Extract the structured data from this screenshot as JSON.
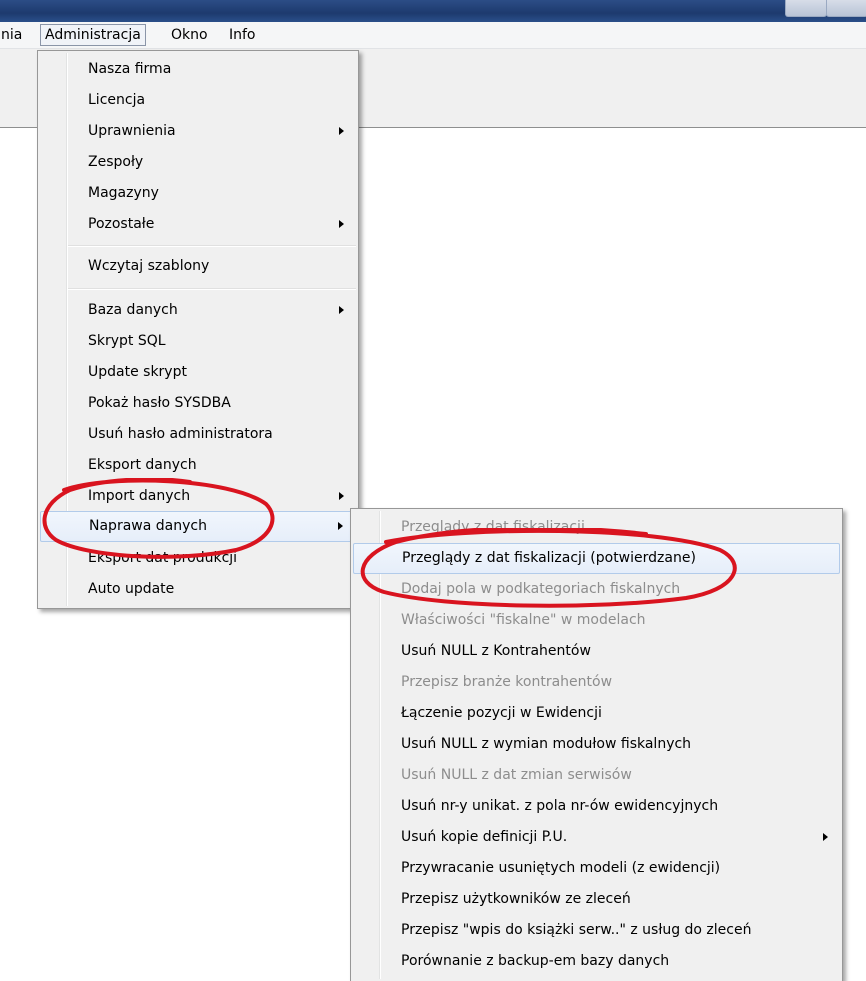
{
  "menubar": {
    "items": [
      "nia",
      "Administracja",
      "Okno",
      "Info"
    ]
  },
  "admin_menu": {
    "items": [
      {
        "label": "Nasza firma",
        "submenu": false
      },
      {
        "label": "Licencja",
        "submenu": false
      },
      {
        "label": "Uprawnienia",
        "submenu": true
      },
      {
        "label": "Zespoły",
        "submenu": false
      },
      {
        "label": "Magazyny",
        "submenu": false
      },
      {
        "label": "Pozostałe",
        "submenu": true
      },
      {
        "label": "Wczytaj szablony",
        "submenu": false
      },
      {
        "label": "Baza danych",
        "submenu": true
      },
      {
        "label": "Skrypt SQL",
        "submenu": false
      },
      {
        "label": "Update skrypt",
        "submenu": false
      },
      {
        "label": "Pokaż hasło SYSDBA",
        "submenu": false
      },
      {
        "label": "Usuń hasło administratora",
        "submenu": false
      },
      {
        "label": "Eksport danych",
        "submenu": false
      },
      {
        "label": "Import danych",
        "submenu": true
      },
      {
        "label": "Naprawa danych",
        "submenu": true
      },
      {
        "label": "Eksport dat produkcji",
        "submenu": false
      },
      {
        "label": "Auto update",
        "submenu": false
      }
    ]
  },
  "repair_menu": {
    "items": [
      {
        "label": "Przeglądy z dat fiskalizacji",
        "disabled": true
      },
      {
        "label": "Przeglądy z dat fiskalizacji (potwierdzane)",
        "disabled": false
      },
      {
        "label": "Dodaj pola w podkategoriach fiskalnych",
        "disabled": true
      },
      {
        "label": "Właściwości \"fiskalne\" w modelach",
        "disabled": true
      },
      {
        "label": "Usuń NULL z Kontrahentów",
        "disabled": false
      },
      {
        "label": "Przepisz branże kontrahentów",
        "disabled": true
      },
      {
        "label": "Łączenie pozycji w Ewidencji",
        "disabled": false
      },
      {
        "label": "Usuń NULL z wymian  modułow fiskalnych",
        "disabled": false
      },
      {
        "label": "Usuń NULL z dat zmian serwisów",
        "disabled": true
      },
      {
        "label": "Usuń nr-y unikat. z pola nr-ów ewidencyjnych",
        "disabled": false
      },
      {
        "label": "Usuń kopie definicji P.U.",
        "disabled": false,
        "submenu": true
      },
      {
        "label": "Przywracanie usuniętych modeli (z ewidencji)",
        "disabled": false
      },
      {
        "label": "Przepisz użytkowników ze zleceń",
        "disabled": false
      },
      {
        "label": "Przepisz \"wpis do książki serw..\" z usług do zleceń",
        "disabled": false
      },
      {
        "label": "Porównanie z backup-em bazy danych",
        "disabled": false
      }
    ]
  },
  "colors": {
    "annotation": "#d9141f",
    "titlebar": "#1d3a6e",
    "disabled_text": "#8d8d8d",
    "hover_border": "#b2cbea"
  }
}
